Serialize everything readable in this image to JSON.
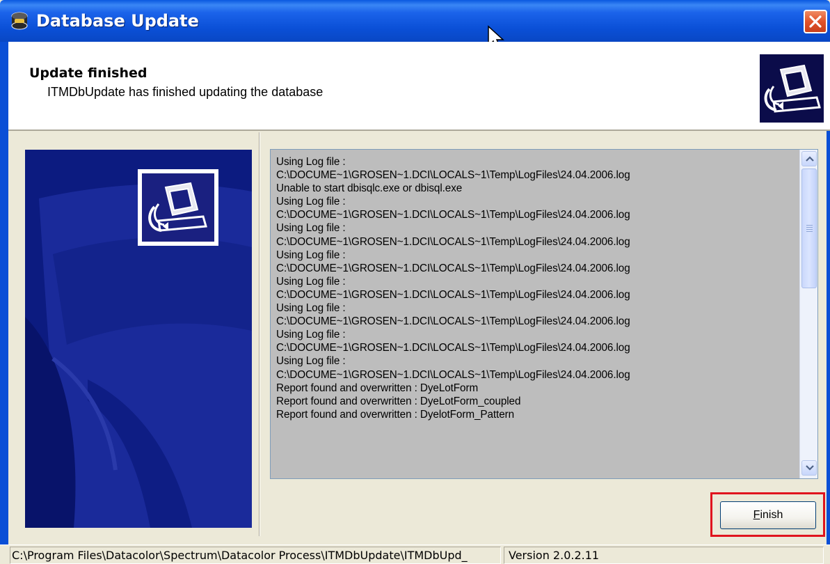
{
  "window": {
    "title": "Database Update"
  },
  "header": {
    "title": "Update finished",
    "subtitle": "ITMDbUpdate has finished updating the database"
  },
  "log": {
    "lines": [
      "Using Log file :",
      "C:\\DOCUME~1\\GROSEN~1.DCI\\LOCALS~1\\Temp\\LogFiles\\24.04.2006.log",
      "Unable to start dbisqlc.exe or dbisql.exe",
      "Using Log file :",
      "C:\\DOCUME~1\\GROSEN~1.DCI\\LOCALS~1\\Temp\\LogFiles\\24.04.2006.log",
      "Using Log file :",
      "C:\\DOCUME~1\\GROSEN~1.DCI\\LOCALS~1\\Temp\\LogFiles\\24.04.2006.log",
      "Using Log file :",
      "C:\\DOCUME~1\\GROSEN~1.DCI\\LOCALS~1\\Temp\\LogFiles\\24.04.2006.log",
      "Using Log file :",
      "C:\\DOCUME~1\\GROSEN~1.DCI\\LOCALS~1\\Temp\\LogFiles\\24.04.2006.log",
      "Using Log file :",
      "C:\\DOCUME~1\\GROSEN~1.DCI\\LOCALS~1\\Temp\\LogFiles\\24.04.2006.log",
      "Using Log file :",
      "C:\\DOCUME~1\\GROSEN~1.DCI\\LOCALS~1\\Temp\\LogFiles\\24.04.2006.log",
      "Using Log file :",
      "C:\\DOCUME~1\\GROSEN~1.DCI\\LOCALS~1\\Temp\\LogFiles\\24.04.2006.log",
      "Report found and overwritten : DyeLotForm",
      "Report found and overwritten : DyeLotForm_coupled",
      "Report found and overwritten : DyelotForm_Pattern"
    ]
  },
  "buttons": {
    "finish_accel": "F",
    "finish_rest": "inish"
  },
  "statusbar": {
    "path": "C:\\Program Files\\Datacolor\\Spectrum\\Datacolor Process\\ITMDbUpdate\\ITMDbUpd_",
    "version": "Version 2.0.2.11"
  },
  "icons": {
    "title": "database-icon",
    "header": "computer-update-icon",
    "close": "close-icon"
  },
  "colors": {
    "titlebar": "#0a4fd6",
    "panel": "#0a1a7a",
    "highlight": "#e0141e",
    "log_bg": "#bdbdbd"
  }
}
